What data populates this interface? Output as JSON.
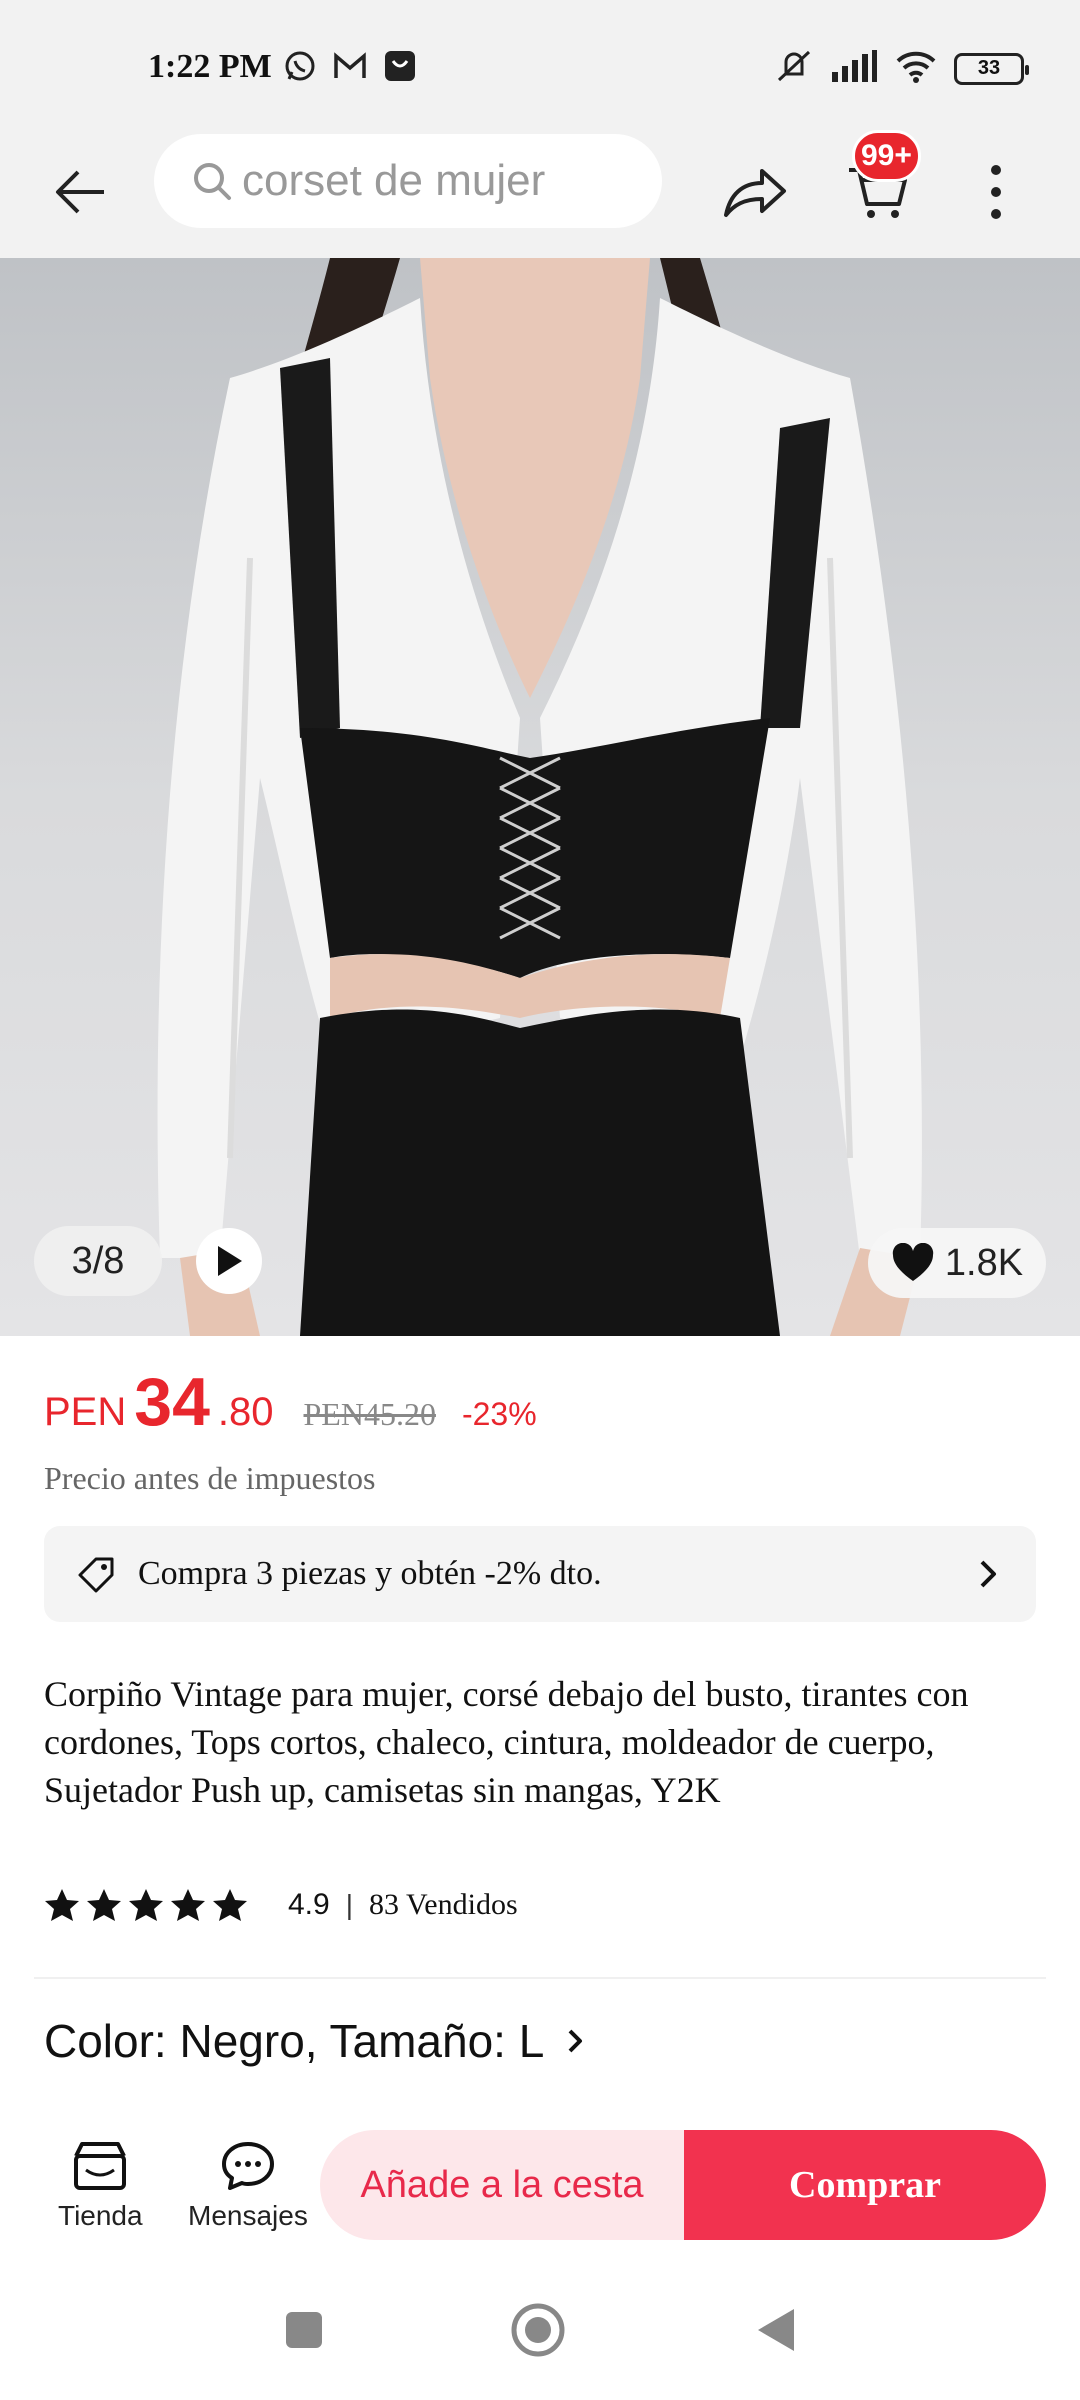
{
  "status_bar": {
    "time": "1:22 PM",
    "battery": "33",
    "icons": [
      "whatsapp-icon",
      "gmail-icon",
      "aliexpress-icon",
      "mute-icon",
      "signal-icon",
      "wifi-icon",
      "battery-icon"
    ]
  },
  "top_nav": {
    "search_text": "corset de mujer",
    "cart_badge": "99+"
  },
  "gallery": {
    "counter": "3/8",
    "likes": "1.8K"
  },
  "price": {
    "currency": "PEN",
    "integer": "34",
    "decimal": ".80",
    "old": "PEN45.20",
    "discount": "-23%",
    "tax_note": "Precio antes de impuestos"
  },
  "promo": {
    "text": "Compra 3 piezas y obtén -2% dto."
  },
  "product": {
    "title": "Corpiño Vintage para mujer, corsé debajo del busto, tirantes con cordones, Tops cortos, chaleco, cintura, moldeador de cuerpo, Sujetador Push up, camisetas sin mangas, Y2K",
    "rating": "4.9",
    "rating_separator": "|",
    "sold": "83 Vendidos",
    "variant": "Color: Negro, Tamaño: L"
  },
  "actions": {
    "store_label": "Tienda",
    "messages_label": "Mensajes",
    "add_to_cart": "Añade a la cesta",
    "buy": "Comprar"
  },
  "colors": {
    "accent": "#e8262d",
    "buy_button": "#f2324f",
    "add_cart_bg": "#fde7ea"
  }
}
